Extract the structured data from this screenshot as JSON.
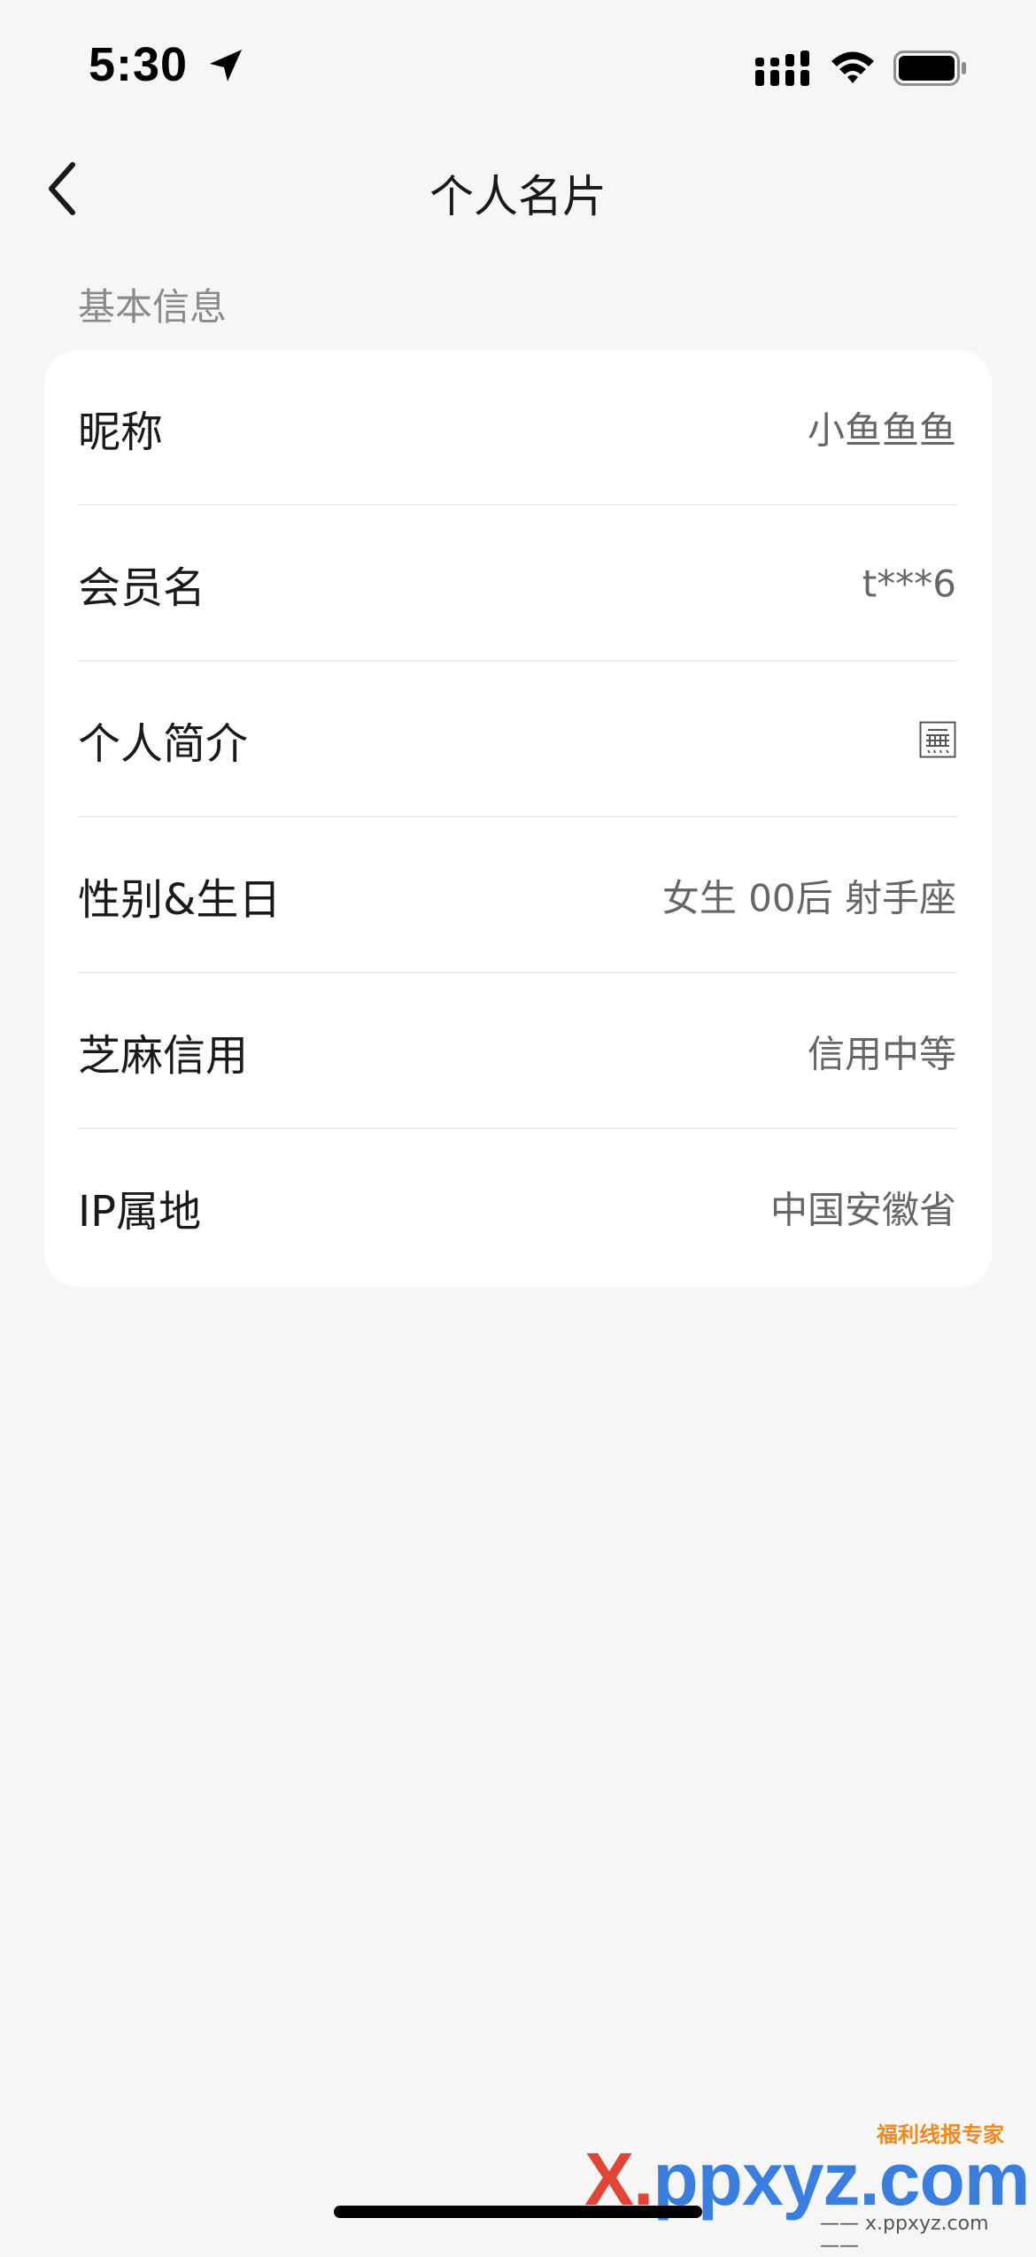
{
  "status_bar": {
    "time": "5:30",
    "icons": [
      "location-arrow-icon",
      "cellular-signal-icon",
      "wifi-icon",
      "battery-icon"
    ]
  },
  "nav": {
    "back_icon": "chevron-left-icon",
    "title": "个人名片"
  },
  "section": {
    "title": "基本信息"
  },
  "rows": [
    {
      "label": "昵称",
      "value": "小鱼鱼鱼"
    },
    {
      "label": "会员名",
      "value": "t***6"
    },
    {
      "label": "个人简介",
      "value": "",
      "value_icon": "empty-glyph-icon"
    },
    {
      "label": "性别&生日",
      "value": "女生 00后 射手座"
    },
    {
      "label": "芝麻信用",
      "value": "信用中等"
    },
    {
      "label": "IP属地",
      "value": "中国安徽省"
    }
  ],
  "watermark": {
    "tag": "福利线报专家",
    "main_x": "X",
    "main_dot": ".",
    "main_rest": "ppxyz.com",
    "sub": "—— x.ppxyz.com ——"
  },
  "colors": {
    "background": "#f6f6f6",
    "card": "#ffffff",
    "label": "#1a1a1a",
    "value": "#666666",
    "section_header": "#8a8a8a"
  }
}
